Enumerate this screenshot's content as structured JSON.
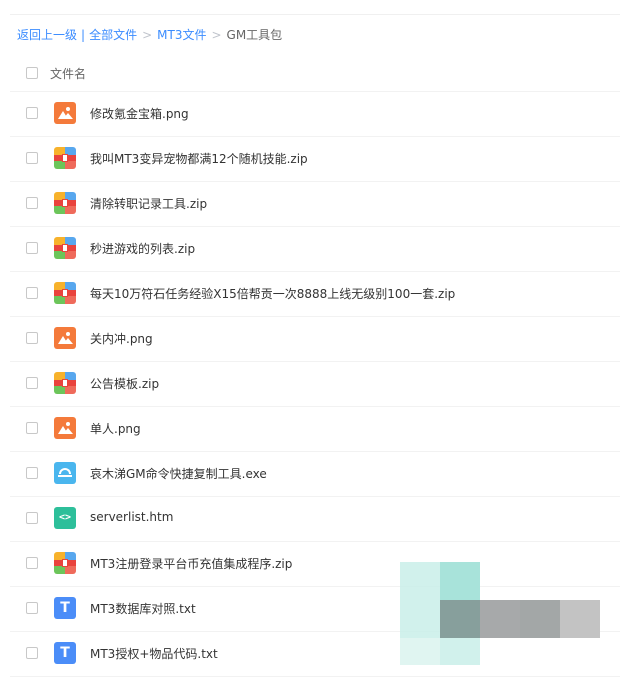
{
  "breadcrumb": {
    "back": "返回上一级",
    "divider": "|",
    "all_files": "全部文件",
    "folder": "MT3文件",
    "current": "GM工具包",
    "separator": ">"
  },
  "table": {
    "column_name": "文件名"
  },
  "files": [
    {
      "name": "修改氪金宝箱.png",
      "type": "image"
    },
    {
      "name": "我叫MT3变异宠物都满12个随机技能.zip",
      "type": "zip"
    },
    {
      "name": "清除转职记录工具.zip",
      "type": "zip"
    },
    {
      "name": "秒进游戏的列表.zip",
      "type": "zip"
    },
    {
      "name": "每天10万符石任务经验X15倍帮贡一次8888上线无级别100一套.zip",
      "type": "zip"
    },
    {
      "name": "关内冲.png",
      "type": "image"
    },
    {
      "name": "公告模板.zip",
      "type": "zip"
    },
    {
      "name": "单人.png",
      "type": "image"
    },
    {
      "name": "哀木涕GM命令快捷复制工具.exe",
      "type": "exe"
    },
    {
      "name": "serverlist.htm",
      "type": "htm"
    },
    {
      "name": "MT3注册登录平台币充值集成程序.zip",
      "type": "zip"
    },
    {
      "name": "MT3数据库对照.txt",
      "type": "txt"
    },
    {
      "name": "MT3授权+物品代码.txt",
      "type": "txt"
    }
  ],
  "icons": {
    "htm_glyph": "<>",
    "txt_glyph": "T"
  },
  "colors": {
    "link": "#3b8cff",
    "image_icon": "#f47a3b",
    "exe_icon": "#4ab6ee",
    "htm_icon": "#2dbf9a",
    "txt_icon": "#4b8df8"
  }
}
